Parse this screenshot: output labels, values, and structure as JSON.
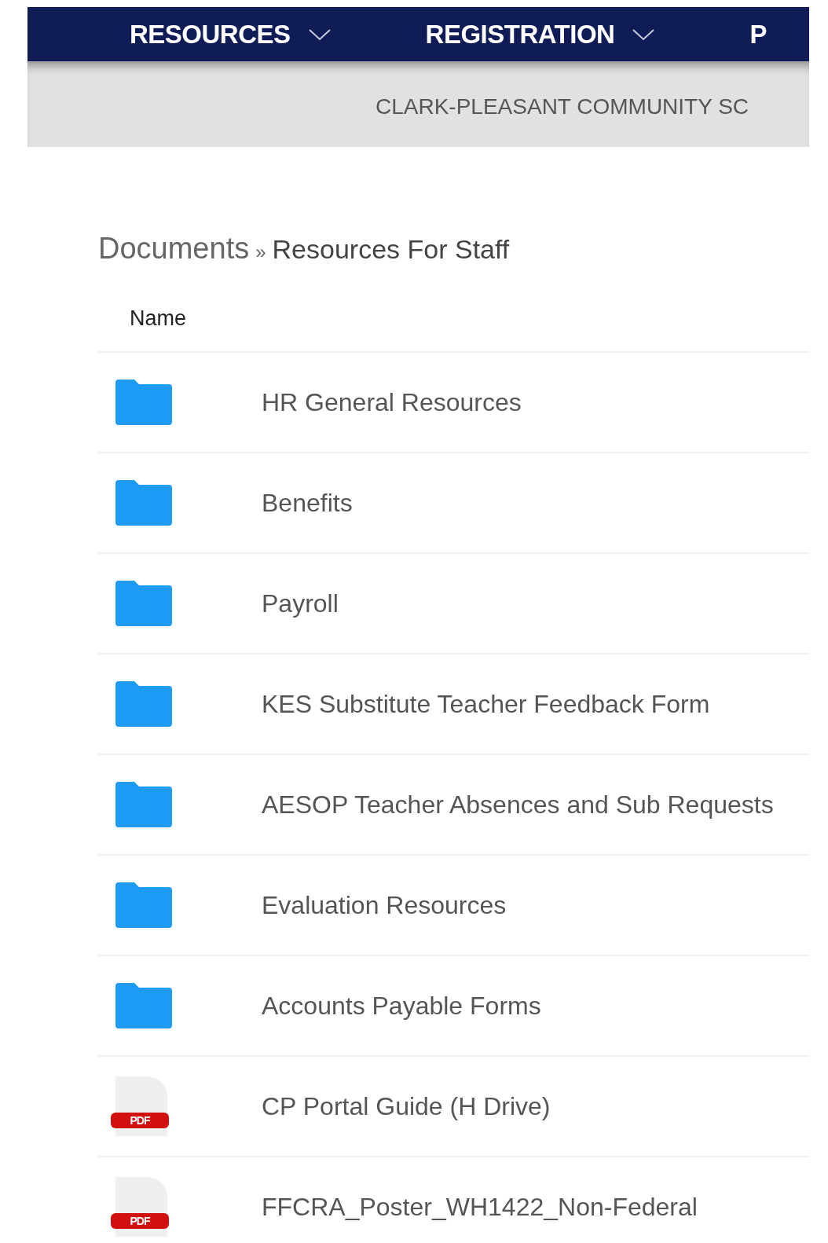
{
  "nav": [
    {
      "label": "RESOURCES",
      "dropdown": true
    },
    {
      "label": "REGISTRATION",
      "dropdown": true
    },
    {
      "label": "P",
      "dropdown": false
    }
  ],
  "banner": {
    "title": "CLARK-PLEASANT COMMUNITY SC"
  },
  "breadcrumb": {
    "root": "Documents",
    "separator": "»",
    "current": "Resources For Staff"
  },
  "table": {
    "columns": [
      "Name"
    ],
    "rows": [
      {
        "kind": "folder",
        "name": "HR General Resources"
      },
      {
        "kind": "folder",
        "name": "Benefits"
      },
      {
        "kind": "folder",
        "name": "Payroll"
      },
      {
        "kind": "folder",
        "name": "KES Substitute Teacher Feedback Form"
      },
      {
        "kind": "folder",
        "name": "AESOP Teacher Absences and Sub Requests"
      },
      {
        "kind": "folder",
        "name": "Evaluation Resources"
      },
      {
        "kind": "folder",
        "name": "Accounts Payable Forms"
      },
      {
        "kind": "pdf",
        "name": "CP Portal Guide (H Drive)",
        "badge": "PDF"
      },
      {
        "kind": "pdf",
        "name": "FFCRA_Poster_WH1422_Non-Federal",
        "badge": "PDF"
      }
    ]
  }
}
